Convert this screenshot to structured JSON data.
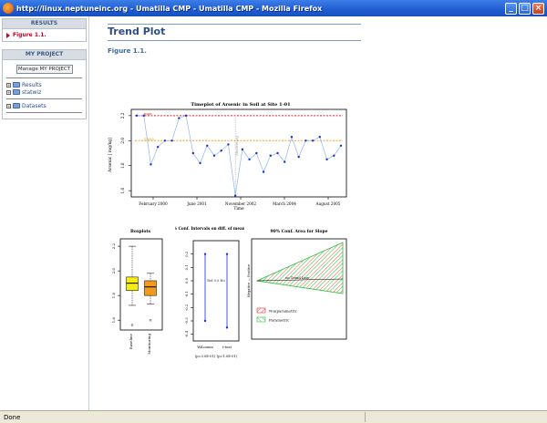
{
  "window": {
    "title": "http://linux.neptuneinc.org - Umatilla CMP - Umatilla CMP - Mozilla Firefox",
    "minimize": "_",
    "maximize": "□",
    "close": "×"
  },
  "sidebar": {
    "results_header": "RESULTS",
    "results_item": "Figure 1.1.",
    "project_header": "MY PROJECT",
    "manage_button": "Manage MY PROJECT",
    "tree": [
      {
        "label": "Results"
      },
      {
        "label": "statwiz"
      },
      {
        "label": "Datasets"
      }
    ]
  },
  "main": {
    "page_title": "Trend Plot",
    "figure_label": "Figure 1.1."
  },
  "status": {
    "text": "Done"
  },
  "chart_data": [
    {
      "type": "scatter",
      "title": "Timeplot of Arsenic in Soil at Site 1-01",
      "xlabel": "Time",
      "ylabel": "Arsenic [ mg/kg]",
      "x_tick_labels": [
        "February 2000",
        "June 2001",
        "November 2002",
        "March 2004",
        "August 2005"
      ],
      "y_tick_labels": [
        "2.2",
        "2.0",
        "1.8",
        "1.6"
      ],
      "ylim": [
        1.55,
        2.25
      ],
      "reference_lines": [
        {
          "name": "max",
          "value": 2.2,
          "color": "#e0262a"
        },
        {
          "name": "mean",
          "value": 2.0,
          "color": "#f0a020"
        }
      ],
      "vertical_label": "Monitoring",
      "values": [
        2.2,
        2.2,
        1.81,
        1.95,
        2.0,
        2.0,
        2.18,
        2.2,
        1.9,
        1.82,
        1.96,
        1.88,
        1.92,
        1.97,
        1.56,
        1.93,
        1.85,
        1.9,
        1.75,
        1.88,
        1.9,
        1.83,
        2.03,
        1.87,
        2.0,
        2.0,
        2.03,
        1.85,
        1.88,
        1.96
      ],
      "grid": false,
      "legend": "none"
    },
    {
      "type": "box",
      "title": "Boxplots",
      "categories": [
        "Baseline",
        "Monitoring"
      ],
      "y_tick_labels": [
        "2.2",
        "2.0",
        "1.8",
        "1.6"
      ],
      "colors": [
        "#f5ec16",
        "#f09a20"
      ],
      "stats": [
        {
          "min": 1.72,
          "q1": 1.84,
          "median": 1.9,
          "q3": 1.95,
          "max": 2.2,
          "outliers": [
            1.56
          ]
        },
        {
          "min": 1.73,
          "q1": 1.8,
          "median": 1.87,
          "q3": 1.92,
          "max": 1.98,
          "outliers": [
            1.6
          ]
        }
      ]
    },
    {
      "type": "interval",
      "title": "90% Conf. Intervals on diff. of mean/median",
      "categories": [
        "Wilcoxon",
        "t-test"
      ],
      "annotations": [
        "(p=3.0E-01)",
        "(p=1.0E-01)"
      ],
      "intervals": [
        {
          "lower": -0.3,
          "estimate": -0.05,
          "upper": 0.2
        },
        {
          "lower": -0.35,
          "estimate": -0.05,
          "upper": 0.2
        }
      ],
      "center_label": "Ref 0.0 Ho"
    },
    {
      "type": "region",
      "title": "90% Conf. Area for Slope",
      "xlabel": "Negative — Positive",
      "center_label": "no Trend Line",
      "legend": [
        "Nonparametric",
        "Parametric"
      ],
      "colors": [
        "#e0262a",
        "#2fbf3a"
      ]
    }
  ]
}
